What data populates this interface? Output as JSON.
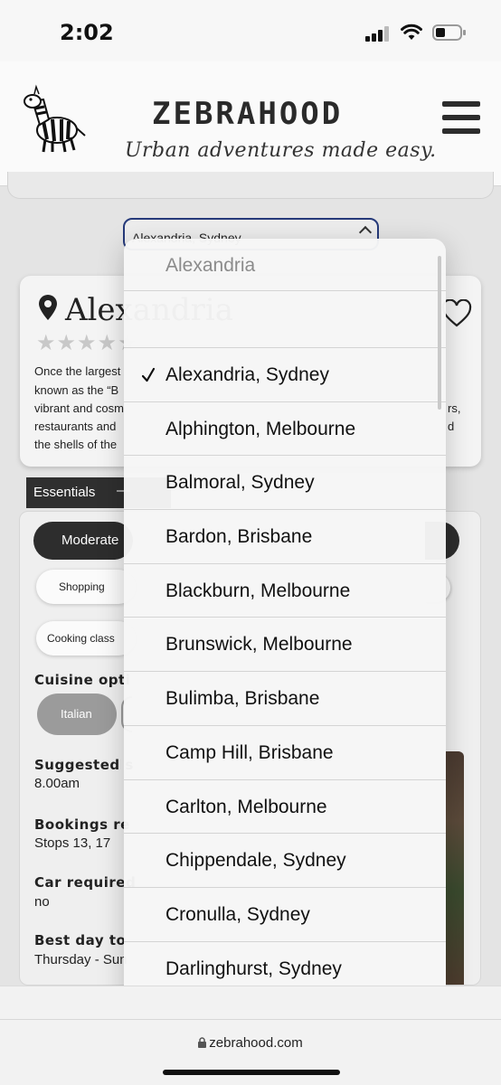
{
  "status_bar": {
    "time": "2:02"
  },
  "header": {
    "brand": "ZEBRAHOOD",
    "tagline": "Urban adventures made easy."
  },
  "location_select": {
    "value": "Alexandria, Sydney"
  },
  "suburb_card": {
    "title": "Alexandria",
    "rating_stars": "★★★★★",
    "rating_value": 0,
    "description_lines": [
      "Once the largest",
      "known as the “B",
      "vibrant and cosm",
      "restaurants and",
      "the shells of the"
    ],
    "description_right": [
      "rs,",
      "d"
    ]
  },
  "essentials": {
    "tab_label": "Essentials",
    "tab_toggle": "—",
    "budget_label": "Moderate",
    "tags": [
      "Shopping",
      "Cooking class"
    ],
    "cuisine_label": "Cuisine opti",
    "cuisine_options": [
      "Italian"
    ],
    "fields": [
      {
        "label": "Suggested s",
        "value": "8.00am"
      },
      {
        "label": "Bookings re",
        "value": "Stops 13, 17"
      },
      {
        "label": "Car required",
        "value": "no"
      },
      {
        "label": "Best day to",
        "value": "Thursday - Sun"
      }
    ]
  },
  "dropdown": {
    "header": "Alexandria",
    "selected": "Alexandria, Sydney",
    "options": [
      "Alexandria, Sydney",
      "Alphington, Melbourne",
      "Balmoral, Sydney",
      "Bardon, Brisbane",
      "Blackburn, Melbourne",
      "Brunswick, Melbourne",
      "Bulimba, Brisbane",
      "Camp Hill, Brisbane",
      "Carlton, Melbourne",
      "Chippendale, Sydney",
      "Cronulla, Sydney",
      "Darlinghurst, Sydney"
    ]
  },
  "browser": {
    "url": "zebrahood.com"
  },
  "colors": {
    "select_border": "#263a7a",
    "pill_dark": "#2d2d2d",
    "pill_grey": "#9b9b9b"
  }
}
